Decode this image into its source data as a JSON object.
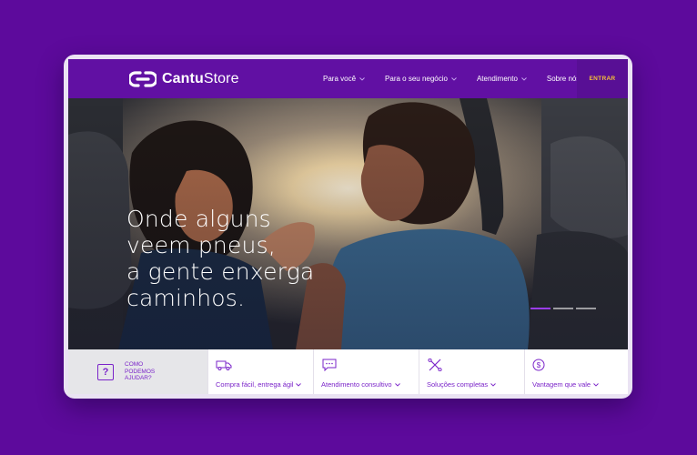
{
  "brand": {
    "name_bold": "Cantu",
    "name_rest": "Store"
  },
  "nav": {
    "items": [
      {
        "label": "Para você"
      },
      {
        "label": "Para o seu negócio"
      },
      {
        "label": "Atendimento"
      },
      {
        "label": "Sobre nós"
      }
    ],
    "login": "ENTRAR"
  },
  "hero": {
    "headline_lines": [
      "Onde alguns",
      "veem pneus,",
      "a gente enxerga",
      "caminhos."
    ],
    "carousel_slides": 3,
    "active_slide": 1
  },
  "help": {
    "line1": "COMO",
    "line2": "PODEMOS",
    "line3": "AJUDAR?",
    "icon": "question-icon"
  },
  "features": [
    {
      "label": "Compra fácil, entrega ágil",
      "icon": "truck-icon"
    },
    {
      "label": "Atendimento consultivo",
      "icon": "chat-icon"
    },
    {
      "label": "Soluções completas",
      "icon": "tools-icon"
    },
    {
      "label": "Vantagem que vale",
      "icon": "dollar-icon"
    }
  ],
  "colors": {
    "background": "#5d0a9c",
    "header": "#6110a3",
    "accent": "#7a23c9",
    "login_text": "#f5c238",
    "active_dot": "#9a3df0"
  }
}
